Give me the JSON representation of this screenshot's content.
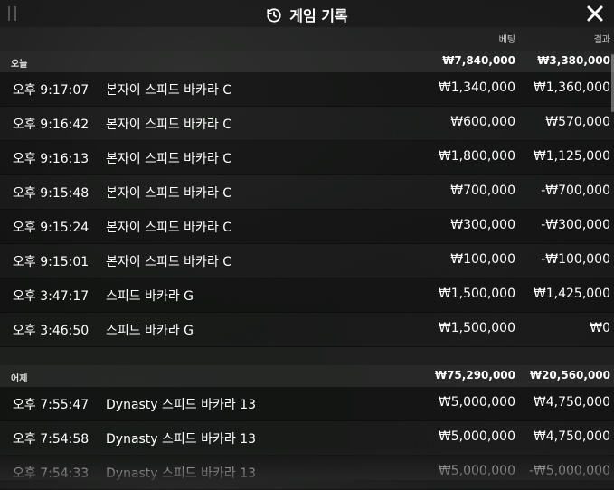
{
  "header": {
    "title": "게임 기록"
  },
  "columns": {
    "bet": "베팅",
    "result": "결과"
  },
  "groups": [
    {
      "label": "오늘",
      "total_bet": "₩7,840,000",
      "total_result": "₩3,380,000",
      "rows": [
        {
          "time": "오후 9:17:07",
          "game": "본자이 스피드 바카라 C",
          "bet": "₩1,340,000",
          "result": "₩1,360,000"
        },
        {
          "time": "오후 9:16:42",
          "game": "본자이 스피드 바카라 C",
          "bet": "₩600,000",
          "result": "₩570,000"
        },
        {
          "time": "오후 9:16:13",
          "game": "본자이 스피드 바카라 C",
          "bet": "₩1,800,000",
          "result": "₩1,125,000"
        },
        {
          "time": "오후 9:15:48",
          "game": "본자이 스피드 바카라 C",
          "bet": "₩700,000",
          "result": "-₩700,000"
        },
        {
          "time": "오후 9:15:24",
          "game": "본자이 스피드 바카라 C",
          "bet": "₩300,000",
          "result": "-₩300,000"
        },
        {
          "time": "오후 9:15:01",
          "game": "본자이 스피드 바카라 C",
          "bet": "₩100,000",
          "result": "-₩100,000"
        },
        {
          "time": "오후 3:47:17",
          "game": "스피드 바카라 G",
          "bet": "₩1,500,000",
          "result": "₩1,425,000"
        },
        {
          "time": "오후 3:46:50",
          "game": "스피드 바카라 G",
          "bet": "₩1,500,000",
          "result": "₩0"
        }
      ]
    },
    {
      "label": "어제",
      "total_bet": "₩75,290,000",
      "total_result": "₩20,560,000",
      "rows": [
        {
          "time": "오후 7:55:47",
          "game": "Dynasty 스피드 바카라 13",
          "bet": "₩5,000,000",
          "result": "₩4,750,000"
        },
        {
          "time": "오후 7:54:58",
          "game": "Dynasty 스피드 바카라 13",
          "bet": "₩5,000,000",
          "result": "₩4,750,000"
        },
        {
          "time": "오후 7:54:33",
          "game": "Dynasty 스피드 바카라 13",
          "bet": "₩5,000,000",
          "result": "-₩5,000,000"
        }
      ]
    }
  ],
  "icons": {
    "history": "history-icon",
    "close": "close-icon",
    "drag": "drag-handle-icon"
  }
}
